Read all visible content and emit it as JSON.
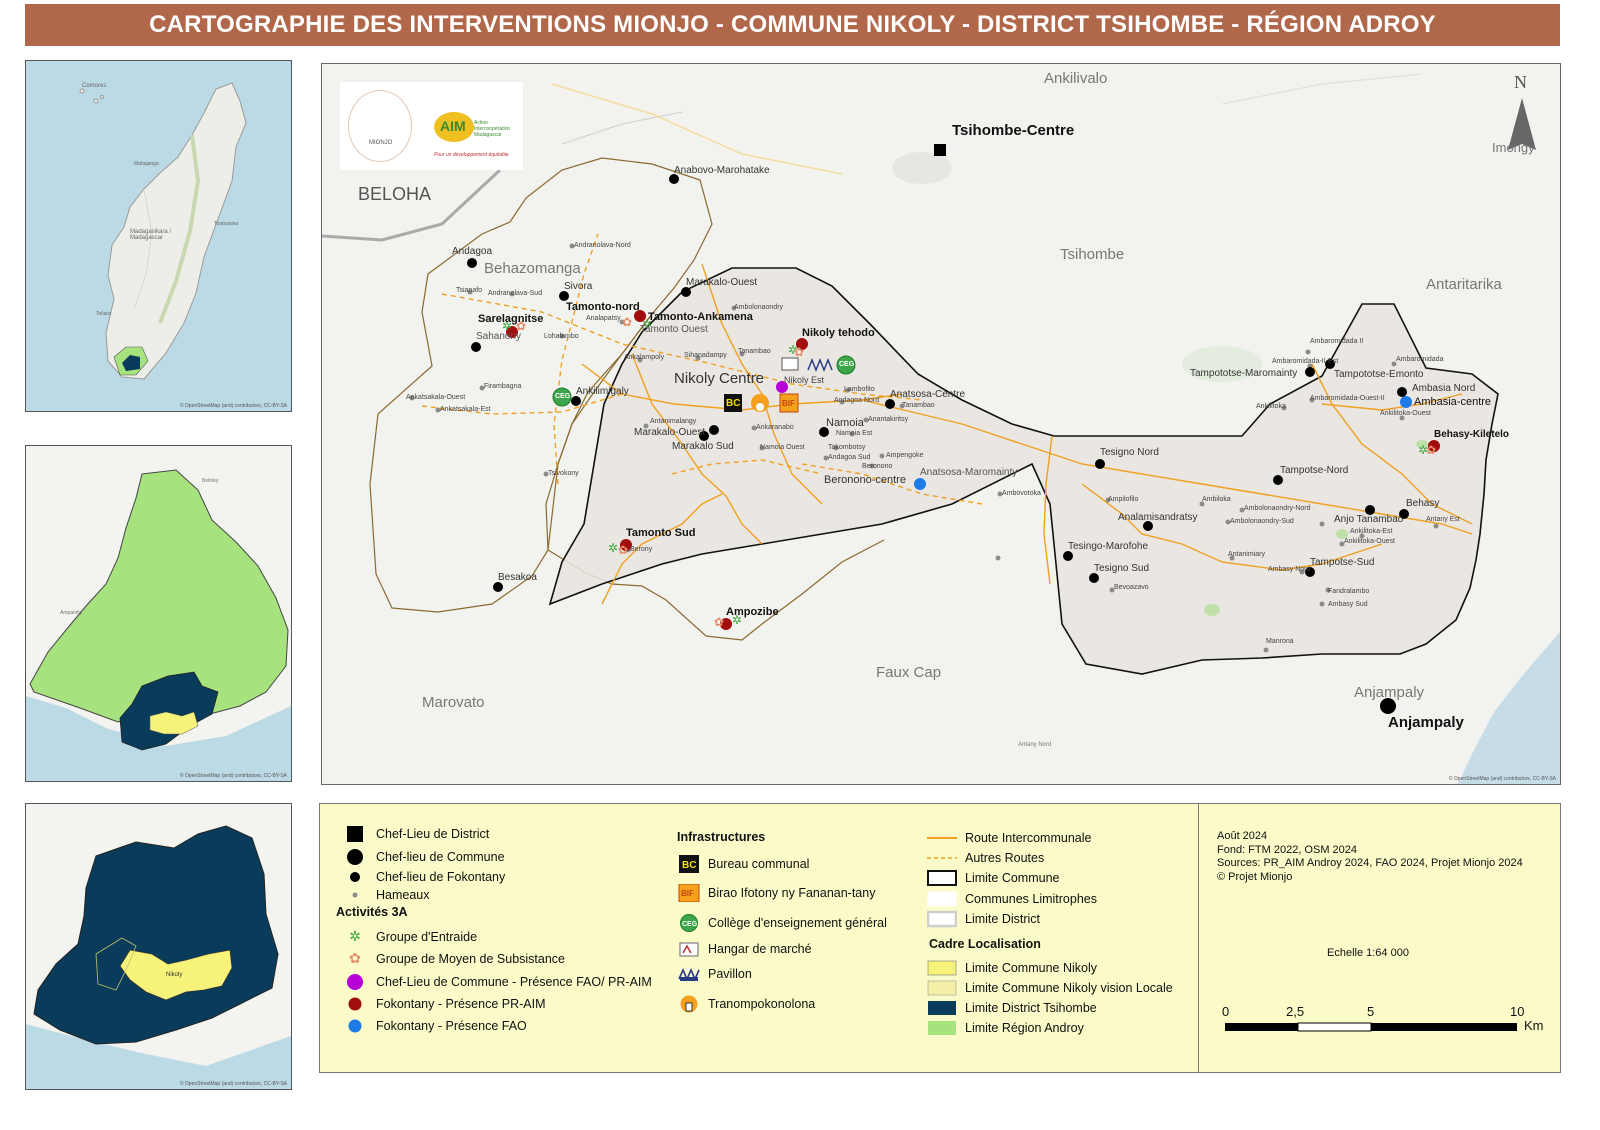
{
  "title": "CARTOGRAPHIE DES INTERVENTIONS MIONJO - COMMUNE NIKOLY - DISTRICT TSIHOMBE - RÉGION ADROY",
  "inset_madagascar": {
    "labels": [
      "Comores",
      "Madagasikara / Madagascar",
      "Mahajanga",
      "Toamasina",
      "Toliara"
    ]
  },
  "inset_region": {
    "labels": [
      "Ampanihy",
      "Betioky"
    ]
  },
  "inset_district": {
    "labels": [
      "Nikoly"
    ]
  },
  "osm_attribution": "© OpenStreetMap (and) contributors, CC-BY-SA",
  "main_map": {
    "neighbor_labels": [
      {
        "id": "ankilivalo",
        "text": "Ankilivalo"
      },
      {
        "id": "beloha",
        "text": "BELOHA"
      },
      {
        "id": "tsihombe",
        "text": "Tsihombe"
      },
      {
        "id": "antaritarika",
        "text": "Antaritarika"
      },
      {
        "id": "imongy",
        "text": "Imongy"
      },
      {
        "id": "faux-cap",
        "text": "Faux Cap"
      },
      {
        "id": "marovato",
        "text": "Marovato"
      },
      {
        "id": "anjampaly-grey",
        "text": "Anjampaly"
      },
      {
        "id": "behazomanga",
        "text": "Behazomanga"
      }
    ],
    "district_seat": "Tsihombe-Centre",
    "commune_seats": [
      "Nikoly Centre",
      "Anjampaly"
    ],
    "fokontany": [
      "Anabovo-Marohatake",
      "Andagoa",
      "Sivora",
      "Tamonto-nord",
      "Marakalo-Ouest",
      "Sarelagnitse",
      "Tamonto-Ankamena",
      "Tamonto Ouest",
      "Sahanony",
      "Ankilimigaly",
      "Nikoly tehodo",
      "Anatsosa-Centre",
      "Namoia",
      "Marakalo-Ouest",
      "Marakalo Sud",
      "Beronono-centre",
      "Anatsosa-Maromainty",
      "Tamonto Sud",
      "Besakoa",
      "Ampozibe",
      "Tesigno Nord",
      "Analamisandratsy",
      "Tesingo-Marofohe",
      "Tesigno Sud",
      "Tampototse-Maromainty",
      "Tampototse-Emonto",
      "Ambasia Nord",
      "Ambasia-centre",
      "Behasy-Kiletelo",
      "Tampotse-Nord",
      "Anjo Tanambao",
      "Behasy",
      "Tampotse-Sud"
    ],
    "hamlets": [
      "Andranolava-Nord",
      "Tsianafo",
      "Andranolava-Sud",
      "Analapatsy",
      "Lohalambo",
      "Ambolonaondry",
      "Ankalampoly",
      "Sihanadampy",
      "Tanambao",
      "Nikoly Est",
      "Lambofito",
      "Andagoa Nord",
      "Tanambao",
      "Firambagna",
      "Ankatsakala-Ouest",
      "Ankatsakala-Est",
      "Antanimalangy",
      "Ankaranabo",
      "Namoia Est",
      "Anantakiritsy",
      "Namoia Ouest",
      "Takombotsy",
      "Andagoa Sud",
      "Ampengoke",
      "Beronono",
      "Tsivokony",
      "Berony",
      "Ambovotoka",
      "Ampilofilo",
      "Bevoazavo",
      "Ambaromidada II",
      "Ambaromidada-II-Est",
      "Ambaromidada",
      "Ankilitoka",
      "Ambaromidada-Ouest-II",
      "Ankilitoka-Ouest",
      "Ambiloka",
      "Ambolonaondry-Nord",
      "Ambolonaondry-Sud",
      "Antanimiary",
      "Ambasy Nord",
      "Ankilitoka-Est",
      "Ankilitoka-Ouest",
      "Antany Est",
      "Fandralambo",
      "Ambasy Sud",
      "Manrona",
      "Antany Nord"
    ],
    "infra_labels": {
      "bc": "BC",
      "bif": "BIF",
      "ceg": "CEG"
    },
    "logos": {
      "mionjo": "MIONJO",
      "aim_letters": "AIM",
      "aim_name": "Action Intercoopération Madagascar",
      "aim_tagline": "Pour un développement équitable"
    },
    "north": "N"
  },
  "legend": {
    "admin": [
      {
        "label": "Chef-Lieu de District",
        "symbol": "square"
      },
      {
        "label": "Chef-lieu de Commune",
        "symbol": "big-dot"
      },
      {
        "label": "Chef-lieu de Fokontany",
        "symbol": "dot"
      },
      {
        "label": "Hameaux",
        "symbol": "small-grey-dot"
      }
    ],
    "activities_title": "Activités 3A",
    "activities": [
      {
        "label": "Groupe d'Entraide",
        "color": "#3aa83a"
      },
      {
        "label": "Groupe de Moyen de Subsistance",
        "color": "#e58f6a"
      },
      {
        "label": "Chef-Lieu de Commune - Présence FAO/ PR-AIM",
        "color": "#b700d8"
      },
      {
        "label": "Fokontany - Présence PR-AIM",
        "color": "#a30d0d"
      },
      {
        "label": "Fokontany - Présence FAO",
        "color": "#1e7be8"
      }
    ],
    "infra_title": "Infrastructures",
    "infra": [
      {
        "label": "Bureau communal",
        "icon": "bc-icon"
      },
      {
        "label": "Birao Ifotony ny Fananan-tany",
        "icon": "bif-icon"
      },
      {
        "label": "Collège d'enseignement général",
        "icon": "ceg-icon"
      },
      {
        "label": "Hangar de marché",
        "icon": "market-hangar-icon"
      },
      {
        "label": "Pavillon",
        "icon": "pavilion-icon"
      },
      {
        "label": "Tranompokonolona",
        "icon": "community-house-icon"
      }
    ],
    "lines": [
      {
        "label": "Route Intercommunale",
        "style": "solid-orange"
      },
      {
        "label": "Autres Routes",
        "style": "dashed-orange"
      },
      {
        "label": "Limite Commune",
        "style": "black-box"
      },
      {
        "label": "Communes Limitrophes",
        "style": "white-box"
      },
      {
        "label": "Limite District",
        "style": "grey-box"
      }
    ],
    "cadre_title": "Cadre Localisation",
    "cadre": [
      {
        "label": "Limite Commune Nikoly",
        "color": "#f7f27a"
      },
      {
        "label": "Limite Commune Nikoly vision Locale",
        "color": "#f5f0a8"
      },
      {
        "label": "Limite District Tsihombe",
        "color": "#083c5a"
      },
      {
        "label": "Limite Région Androy",
        "color": "#a6e27e"
      }
    ],
    "info": [
      "Août 2024",
      "Fond: FTM 2022, OSM 2024",
      "Sources: PR_AIM Androy 2024, FAO 2024, Projet Mionjo 2024",
      "© Projet Mionjo"
    ],
    "scale": {
      "title": "Echelle   1:64 000",
      "ticks": [
        "0",
        "2,5",
        "5",
        "10"
      ],
      "unit": "Km"
    }
  },
  "colors": {
    "title_bg": "#b0674a",
    "sea": "#bcd9e6",
    "region_green": "#a6e27e",
    "district_navy": "#083c5a",
    "nikoly_yellow": "#f7f27a",
    "legend_bg": "#fbfbc9",
    "road_orange": "#f0a020"
  }
}
